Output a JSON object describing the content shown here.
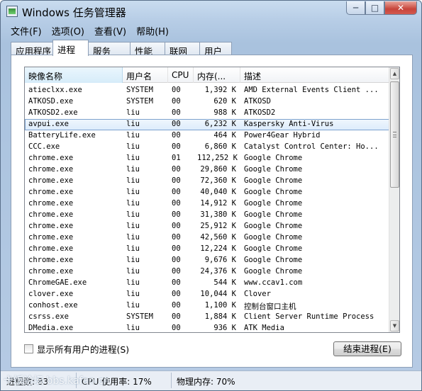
{
  "window": {
    "title": "Windows 任务管理器",
    "controls": {
      "minimize": "─",
      "maximize": "□",
      "close": "✕"
    }
  },
  "menu": [
    {
      "label": "文件(F)"
    },
    {
      "label": "选项(O)"
    },
    {
      "label": "查看(V)"
    },
    {
      "label": "帮助(H)"
    }
  ],
  "tabs": [
    {
      "label": "应用程序"
    },
    {
      "label": "进程",
      "active": true
    },
    {
      "label": "服务"
    },
    {
      "label": "性能"
    },
    {
      "label": "联网"
    },
    {
      "label": "用户"
    }
  ],
  "table": {
    "columns": [
      "映像名称",
      "用户名",
      "CPU",
      "内存(...",
      "描述"
    ],
    "sort_indicator": "^",
    "rows": [
      [
        "atieclxx.exe",
        "SYSTEM",
        "00",
        "1,392 K",
        "AMD External Events Client ..."
      ],
      [
        "ATKOSD.exe",
        "SYSTEM",
        "00",
        "620 K",
        "ATKOSD"
      ],
      [
        "ATKOSD2.exe",
        "liu",
        "00",
        "988 K",
        "ATKOSD2"
      ],
      [
        "avpui.exe",
        "liu",
        "00",
        "6,232 K",
        "Kaspersky Anti-Virus"
      ],
      [
        "BatteryLife.exe",
        "liu",
        "00",
        "464 K",
        "Power4Gear Hybrid"
      ],
      [
        "CCC.exe",
        "liu",
        "00",
        "6,860 K",
        "Catalyst Control Center: Ho..."
      ],
      [
        "chrome.exe",
        "liu",
        "01",
        "112,252 K",
        "Google Chrome"
      ],
      [
        "chrome.exe",
        "liu",
        "00",
        "29,860 K",
        "Google Chrome"
      ],
      [
        "chrome.exe",
        "liu",
        "00",
        "72,360 K",
        "Google Chrome"
      ],
      [
        "chrome.exe",
        "liu",
        "00",
        "40,040 K",
        "Google Chrome"
      ],
      [
        "chrome.exe",
        "liu",
        "00",
        "14,912 K",
        "Google Chrome"
      ],
      [
        "chrome.exe",
        "liu",
        "00",
        "31,380 K",
        "Google Chrome"
      ],
      [
        "chrome.exe",
        "liu",
        "00",
        "25,912 K",
        "Google Chrome"
      ],
      [
        "chrome.exe",
        "liu",
        "00",
        "42,560 K",
        "Google Chrome"
      ],
      [
        "chrome.exe",
        "liu",
        "00",
        "12,224 K",
        "Google Chrome"
      ],
      [
        "chrome.exe",
        "liu",
        "00",
        "9,676 K",
        "Google Chrome"
      ],
      [
        "chrome.exe",
        "liu",
        "00",
        "24,376 K",
        "Google Chrome"
      ],
      [
        "ChromeGAE.exe",
        "liu",
        "00",
        "544 K",
        "www.ccav1.com"
      ],
      [
        "clover.exe",
        "liu",
        "00",
        "10,044 K",
        "Clover"
      ],
      [
        "conhost.exe",
        "liu",
        "00",
        "1,100 K",
        "控制台窗口主机"
      ],
      [
        "csrss.exe",
        "SYSTEM",
        "00",
        "1,884 K",
        "Client Server Runtime Process"
      ],
      [
        "DMedia.exe",
        "liu",
        "00",
        "936 K",
        "ATK Media"
      ]
    ],
    "selected_row_index": 3
  },
  "footer": {
    "show_all_users_label": "显示所有用户的进程(S)",
    "end_process_label": "结束进程(E)"
  },
  "status": {
    "processes": "进程数: 83",
    "cpu": "CPU 使用率: 17%",
    "memory": "物理内存: 70%",
    "watermark": "卡饭论坛 bbs.kafan.cn"
  }
}
